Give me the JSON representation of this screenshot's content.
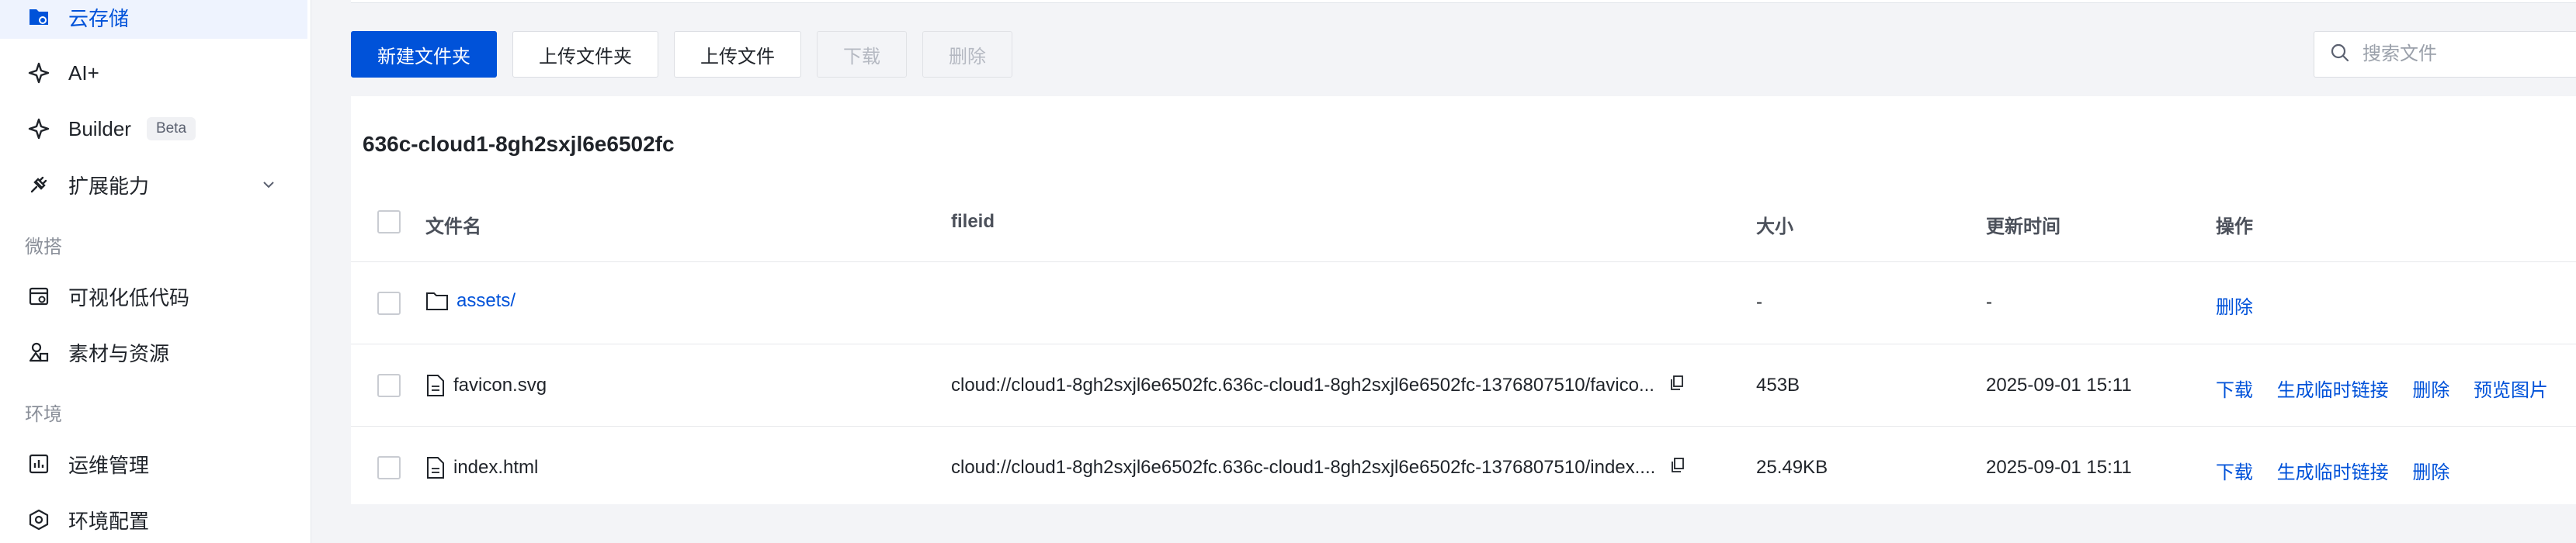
{
  "sidebar": {
    "items": [
      {
        "label": "云存储",
        "icon": "cloud-storage-icon",
        "active": true
      },
      {
        "label": "AI+",
        "icon": "sparkle-icon"
      },
      {
        "label": "Builder",
        "icon": "sparkle-icon",
        "badge": "Beta"
      },
      {
        "label": "扩展能力",
        "icon": "plug-icon"
      }
    ],
    "section_micro": "微搭",
    "micro_items": [
      {
        "label": "可视化低代码",
        "icon": "browser-icon"
      },
      {
        "label": "素材与资源",
        "icon": "shapes-icon"
      }
    ],
    "section_env": "环境",
    "env_items": [
      {
        "label": "运维管理",
        "icon": "chart-icon"
      },
      {
        "label": "环境配置",
        "icon": "settings-cube-icon"
      }
    ]
  },
  "toolbar": {
    "new_folder": "新建文件夹",
    "upload_folder": "上传文件夹",
    "upload_file": "上传文件",
    "download": "下载",
    "delete": "删除"
  },
  "search": {
    "placeholder": "搜索文件"
  },
  "bucket": {
    "name": "636c-cloud1-8gh2sxjl6e6502fc"
  },
  "table": {
    "headers": {
      "name": "文件名",
      "fileid": "fileid",
      "size": "大小",
      "updated": "更新时间",
      "ops": "操作"
    },
    "rows": [
      {
        "name": "assets/",
        "type": "folder",
        "fileid": "",
        "size": "-",
        "updated": "-",
        "ops": [
          "删除"
        ]
      },
      {
        "name": "favicon.svg",
        "type": "file",
        "fileid": "cloud://cloud1-8gh2sxjl6e6502fc.636c-cloud1-8gh2sxjl6e6502fc-1376807510/favico...",
        "size": "453B",
        "updated": "2025-09-01 15:11",
        "ops": [
          "下载",
          "生成临时链接",
          "删除",
          "预览图片"
        ]
      },
      {
        "name": "index.html",
        "type": "file",
        "fileid": "cloud://cloud1-8gh2sxjl6e6502fc.636c-cloud1-8gh2sxjl6e6502fc-1376807510/index....",
        "size": "25.49KB",
        "updated": "2025-09-01 15:11",
        "ops": [
          "下载",
          "生成临时链接",
          "删除"
        ]
      }
    ]
  },
  "colors": {
    "primary": "#0052d9",
    "active_bg": "#eef3fe"
  }
}
